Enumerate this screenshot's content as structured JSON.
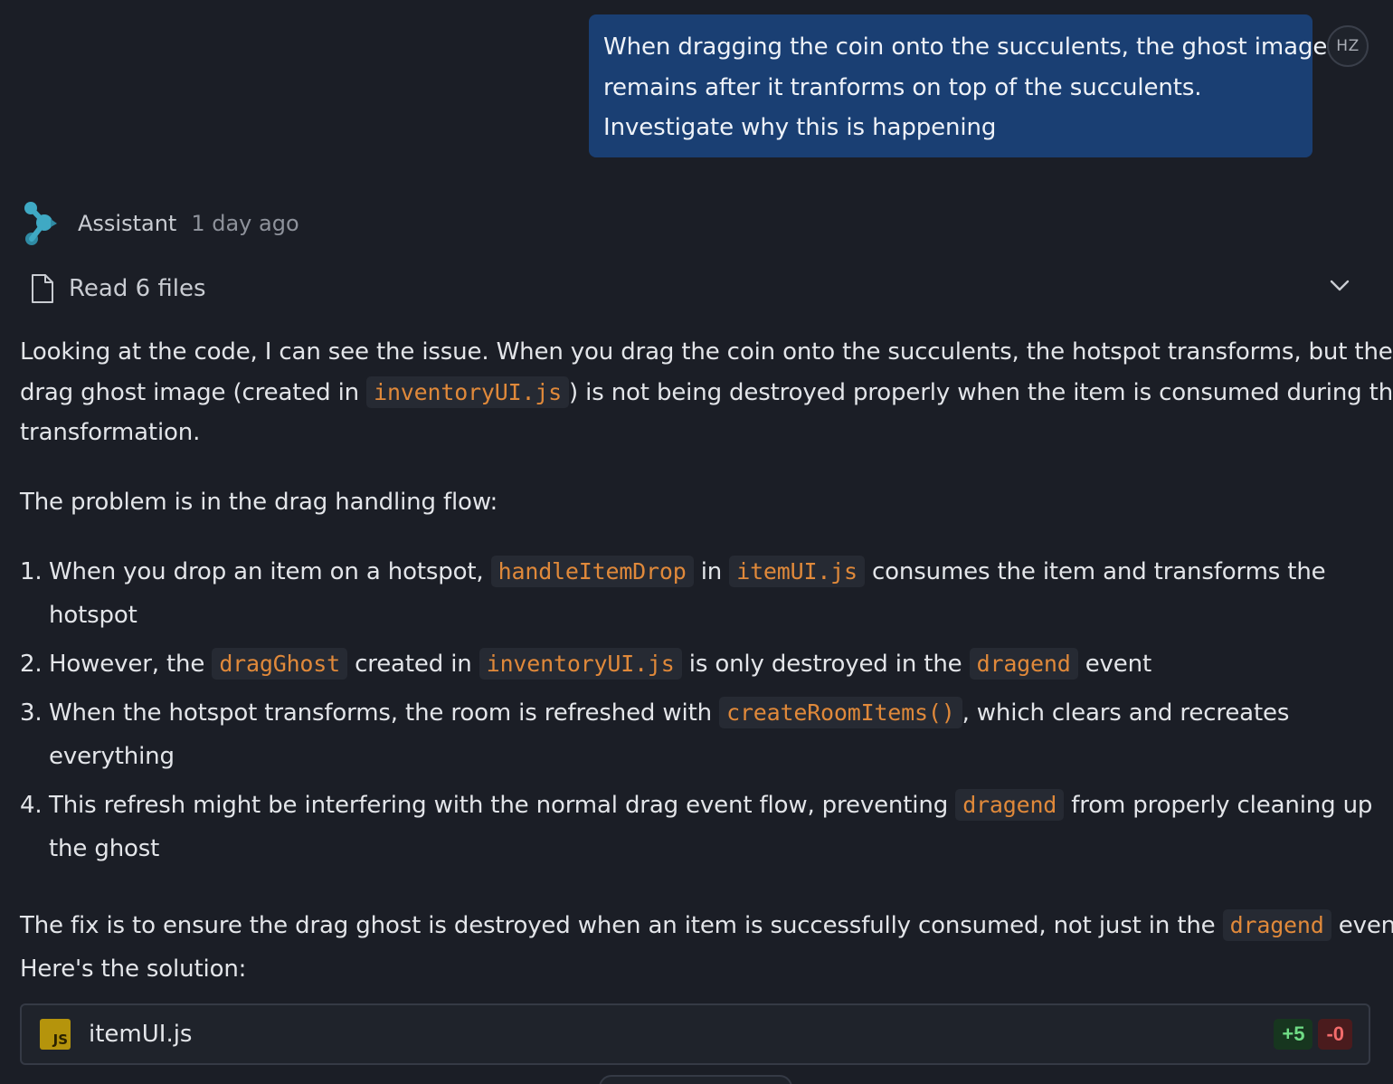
{
  "user_message": {
    "lines": [
      "When dragging the coin onto the succulents, the ghost image",
      "remains after it tranforms on top of the succulents.",
      "Investigate why this is happening"
    ],
    "avatar_initials": "HZ"
  },
  "assistant": {
    "name": "Assistant",
    "time": "1 day ago",
    "logo_icon": "assistant-logo",
    "logo_color": "#3fa9c4"
  },
  "read_files": {
    "label": "Read 6 files",
    "icon": "file-icon",
    "toggle_icon": "chevron-down-icon"
  },
  "intro": {
    "l1": "Looking at the code, I can see the issue. When you drag the coin onto the succulents, the hotspot transforms, but the",
    "l2a": "drag ghost image (created in ",
    "l2code": "inventoryUI.js",
    "l2b": ") is not being destroyed properly when the item is consumed during the",
    "l3": "transformation."
  },
  "problem_intro": "The problem is in the drag handling flow:",
  "list": [
    {
      "num": "1.",
      "a": "When you drop an item on a hotspot, ",
      "code1": "handleItemDrop",
      "b": " in ",
      "code2": "itemUI.js",
      "c": " consumes the item and transforms the",
      "d": "hotspot"
    },
    {
      "num": "2.",
      "a": "However, the ",
      "code1": "dragGhost",
      "b": " created in ",
      "code2": "inventoryUI.js",
      "c": " is only destroyed in the ",
      "code3": "dragend",
      "d": " event"
    },
    {
      "num": "3.",
      "a": "When the hotspot transforms, the room is refreshed with ",
      "code1": "createRoomItems()",
      "b": ", which clears and recreates",
      "c": "everything"
    },
    {
      "num": "4.",
      "a": "This refresh might be interfering with the normal drag event flow, preventing ",
      "code1": "dragend",
      "b": " from properly cleaning up",
      "c": "the ghost"
    }
  ],
  "fix": {
    "a": "The fix is to ensure the drag ghost is destroyed when an item is successfully consumed, not just in the ",
    "code": "dragend",
    "b": " event.",
    "l2": "Here's the solution:"
  },
  "file_card": {
    "badge": "JS",
    "name": "itemUI.js",
    "added": "+5",
    "removed": "-0",
    "colors": {
      "added": "#6fdc85",
      "removed": "#f26b6b",
      "badge": "#b5940c"
    }
  },
  "colors": {
    "background": "#1b1e26",
    "user_bubble": "#1a3f73",
    "inline_code": "#e0893a"
  }
}
